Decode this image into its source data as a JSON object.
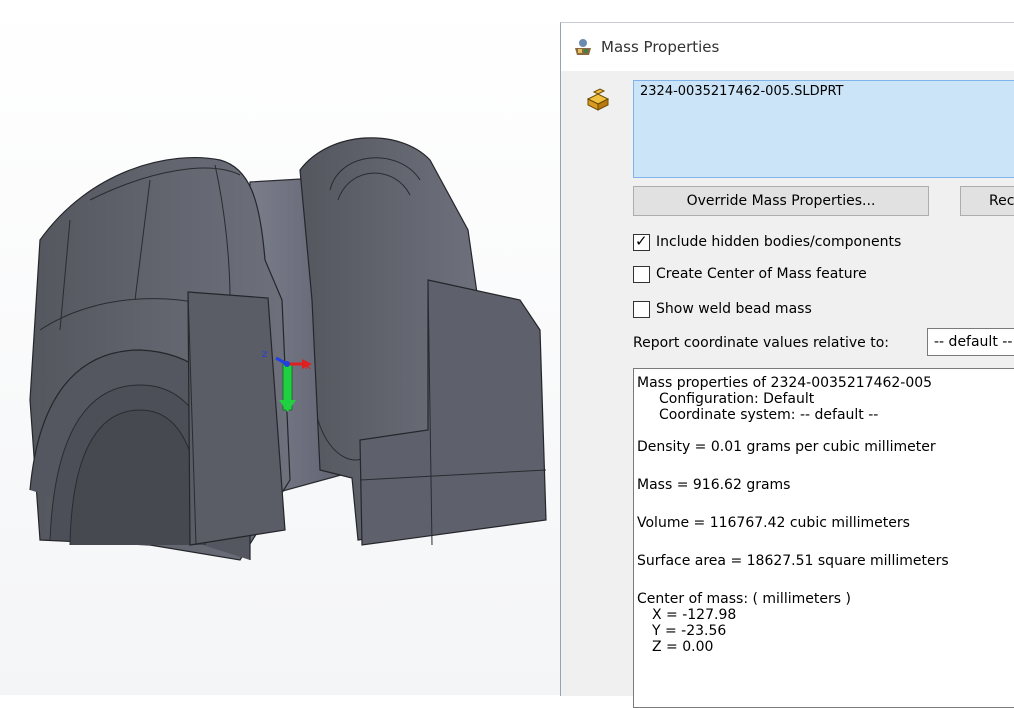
{
  "dialog": {
    "title": "Mass Properties",
    "selected_item": "2324-0035217462-005.SLDPRT",
    "override_button": "Override Mass Properties...",
    "recalculate_button": "Recalculate",
    "checkboxes": [
      {
        "label": "Include hidden bodies/components",
        "checked": true
      },
      {
        "label": "Create Center of Mass feature",
        "checked": false
      },
      {
        "label": "Show weld bead mass",
        "checked": false
      }
    ],
    "report_label": "Report coordinate values relative to:",
    "coordinate_system_value": "-- default --"
  },
  "results": {
    "header": "Mass properties of 2324-0035217462-005",
    "configuration": "Configuration: Default",
    "coordinate_system": "Coordinate system: -- default --",
    "density": "Density = 0.01 grams per cubic millimeter",
    "mass": "Mass = 916.62 grams",
    "volume": "Volume = 116767.42 cubic millimeters",
    "surface_area": "Surface area = 18627.51  square millimeters",
    "center_of_mass_label": "Center of mass: ( millimeters )",
    "com_x": "X = -127.98",
    "com_y": "Y = -23.56",
    "com_z": "Z = 0.00"
  },
  "triad": {
    "x_label": "x",
    "y_label": "Y",
    "z_label": "z"
  },
  "colors": {
    "part_fill": "#62646f",
    "selection_bg": "#cce4f7",
    "triad_x": "#e02020",
    "triad_y": "#20d040",
    "triad_z": "#2040e0"
  },
  "icons": {
    "title": "mass-properties-scale-icon",
    "part": "part-block-icon"
  }
}
